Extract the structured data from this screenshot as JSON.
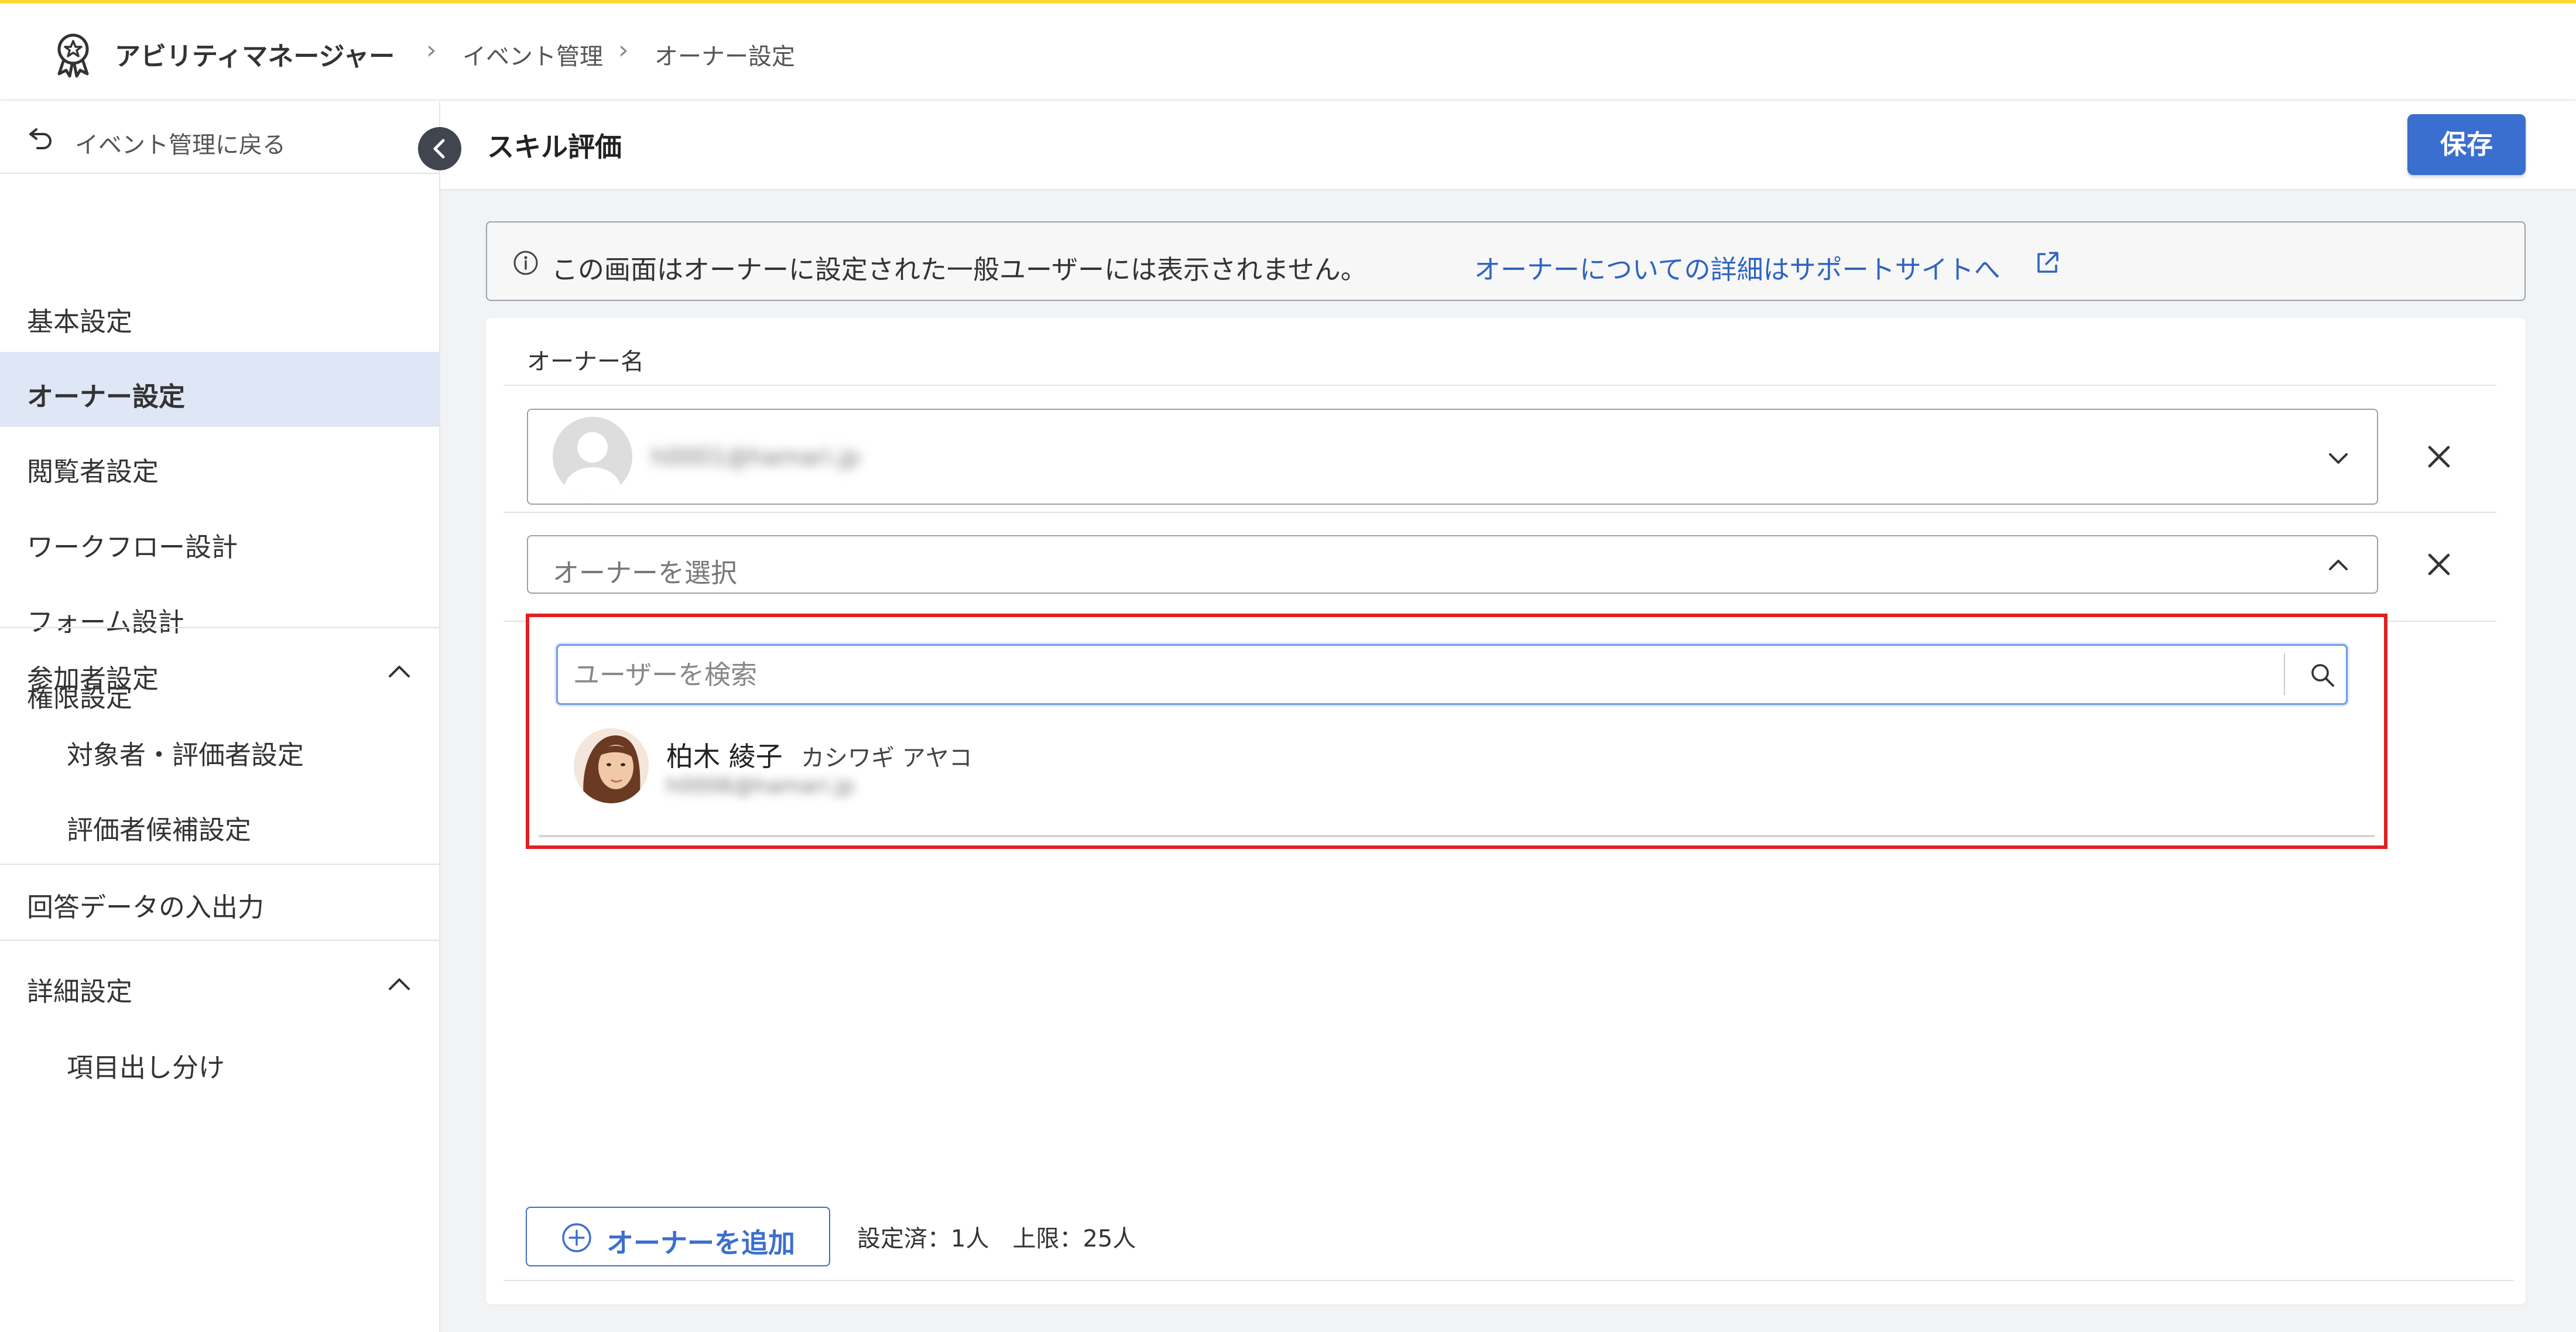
{
  "header": {
    "app_title": "アビリティマネージャー",
    "breadcrumb": [
      "イベント管理",
      "オーナー設定"
    ]
  },
  "sidebar": {
    "back_label": "イベント管理に戻る",
    "items": [
      {
        "label": "基本設定"
      },
      {
        "label": "オーナー設定",
        "active": true
      },
      {
        "label": "閲覧者設定"
      },
      {
        "label": "ワークフロー設計"
      },
      {
        "label": "フォーム設計"
      },
      {
        "label": "権限設定"
      },
      {
        "label": "参加者設定",
        "expanded": true
      },
      {
        "label": "対象者・評価者設定"
      },
      {
        "label": "評価者候補設定"
      },
      {
        "label": "回答データの入出力"
      },
      {
        "label": "詳細設定",
        "expanded": true
      },
      {
        "label": "項目出し分け"
      }
    ]
  },
  "main": {
    "page_title": "スキル評価",
    "save_label": "保存",
    "notice": {
      "text": "この画面はオーナーに設定された一般ユーザーには表示されません。",
      "link": "オーナーについての詳細はサポートサイトへ"
    },
    "owner_section_label": "オーナー名",
    "selected_owner_email": "h0001@hamari.jp",
    "owner_select_placeholder": "オーナーを選択",
    "dropdown": {
      "search_placeholder": "ユーザーを検索",
      "results": [
        {
          "name": "柏木 綾子",
          "kana": "カシワギ アヤコ",
          "email": "h0006@hamari.jp"
        }
      ]
    },
    "add_owner_label": "オーナーを追加",
    "count_text": "設定済：1人　上限：25人"
  },
  "colors": {
    "accent": "#3b6fcf",
    "top_border": "#fdd835",
    "highlight_frame": "#e02020",
    "active_item_bg": "#dfe6f6"
  },
  "icons": [
    "ribbon-logo-icon",
    "undo-arrow-icon",
    "chevron-left-icon",
    "chevron-up-icon",
    "chevron-down-icon",
    "info-icon",
    "external-link-icon",
    "close-icon",
    "search-icon",
    "plus-circle-icon"
  ]
}
